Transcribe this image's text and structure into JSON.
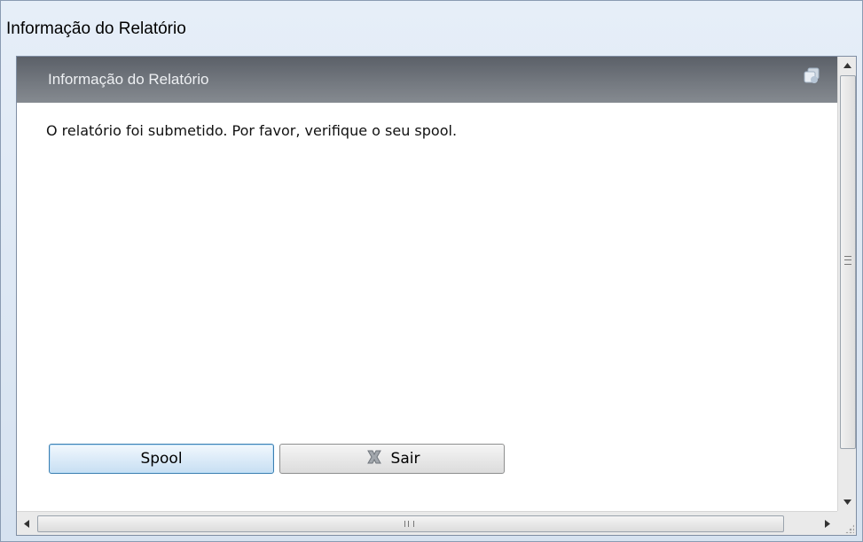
{
  "window": {
    "title": "Informação do Relatório"
  },
  "panel": {
    "title": "Informação do Relatório",
    "restore_icon": "window-restore-icon"
  },
  "message": "O relatório foi submetido. Por favor, verifique o seu spool.",
  "buttons": {
    "spool_label": "Spool",
    "exit_label": "Sair",
    "exit_icon": "close-x-icon"
  },
  "colors": {
    "header_dark": "#5b6068",
    "spool_border": "#3c7fb1",
    "exit_icon_gray": "#8a8f96"
  }
}
